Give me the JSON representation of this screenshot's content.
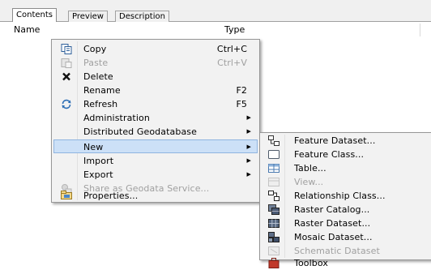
{
  "tabs": [
    "Contents",
    "Preview",
    "Description"
  ],
  "columns": {
    "name": "Name",
    "type": "Type"
  },
  "context_menu": [
    {
      "label": "Copy",
      "shortcut": "Ctrl+C",
      "icon": "copy-icon",
      "enabled": true
    },
    {
      "label": "Paste",
      "shortcut": "Ctrl+V",
      "icon": "paste-icon",
      "enabled": false
    },
    {
      "label": "Delete",
      "shortcut": "",
      "icon": "delete-icon",
      "enabled": true
    },
    {
      "label": "Rename",
      "shortcut": "F2",
      "icon": "",
      "enabled": true
    },
    {
      "label": "Refresh",
      "shortcut": "F5",
      "icon": "refresh-icon",
      "enabled": true
    },
    {
      "label": "Administration",
      "submenu": true,
      "enabled": true
    },
    {
      "label": "Distributed Geodatabase",
      "submenu": true,
      "enabled": true
    },
    {
      "label": "New",
      "submenu": true,
      "enabled": true,
      "highlighted": true
    },
    {
      "label": "Import",
      "submenu": true,
      "enabled": true
    },
    {
      "label": "Export",
      "submenu": true,
      "enabled": true
    },
    {
      "label": "Share as Geodata Service...",
      "icon": "share-icon",
      "enabled": false
    },
    {
      "label": "Properties...",
      "icon": "properties-icon",
      "enabled": true
    }
  ],
  "new_submenu": [
    {
      "label": "Feature Dataset...",
      "icon": "feature-dataset-icon",
      "enabled": true
    },
    {
      "label": "Feature Class...",
      "icon": "feature-class-icon",
      "enabled": true
    },
    {
      "label": "Table...",
      "icon": "table-icon",
      "enabled": true
    },
    {
      "label": "View...",
      "icon": "view-icon",
      "enabled": false
    },
    {
      "label": "Relationship Class...",
      "icon": "relationship-class-icon",
      "enabled": true
    },
    {
      "label": "Raster Catalog...",
      "icon": "raster-catalog-icon",
      "enabled": true
    },
    {
      "label": "Raster Dataset...",
      "icon": "raster-dataset-icon",
      "enabled": true
    },
    {
      "label": "Mosaic Dataset...",
      "icon": "mosaic-dataset-icon",
      "enabled": true
    },
    {
      "label": "Schematic Dataset",
      "icon": "schematic-dataset-icon",
      "enabled": false
    },
    {
      "label": "Toolbox",
      "icon": "toolbox-icon",
      "enabled": true
    }
  ],
  "colors": {
    "highlight": "#cce0f7",
    "highlight_border": "#8fb4e0",
    "disabled_text": "#a0a0a0",
    "menu_bg": "#f2f2f2"
  }
}
